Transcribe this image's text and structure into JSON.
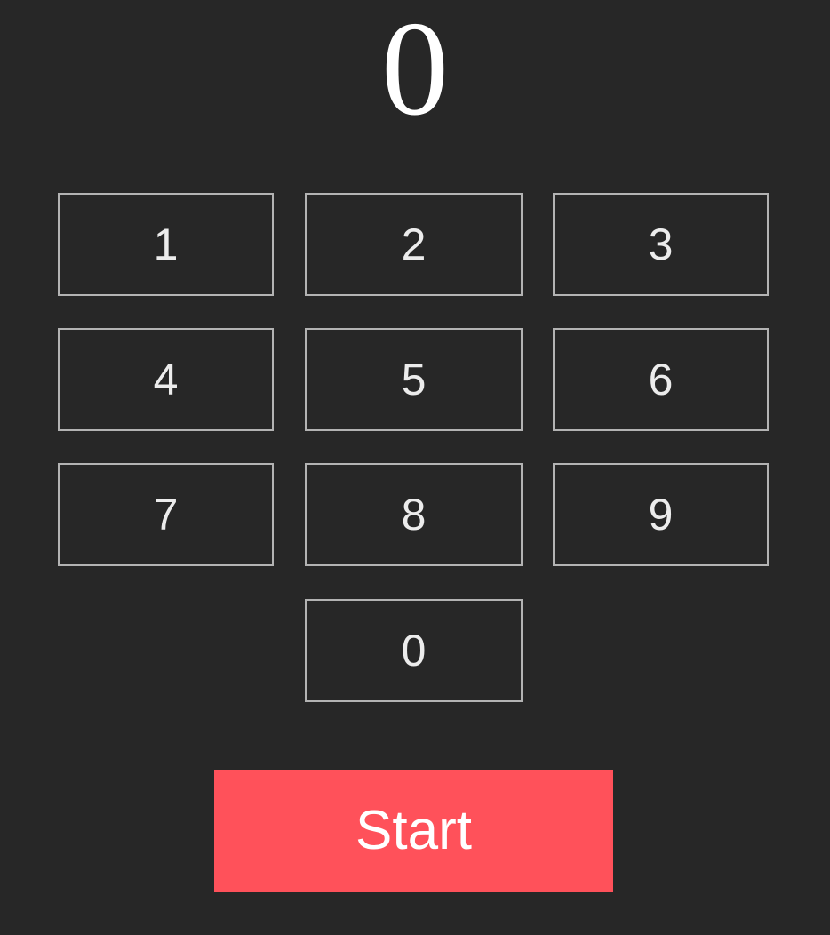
{
  "display": {
    "value": "0"
  },
  "keypad": {
    "keys": [
      "1",
      "2",
      "3",
      "4",
      "5",
      "6",
      "7",
      "8",
      "9",
      "0"
    ]
  },
  "start_button": {
    "label": "Start"
  },
  "colors": {
    "background": "#272727",
    "key_border": "#b3b3b3",
    "key_text": "#ececec",
    "start_background": "#ff515a",
    "start_text": "#ffffff"
  }
}
